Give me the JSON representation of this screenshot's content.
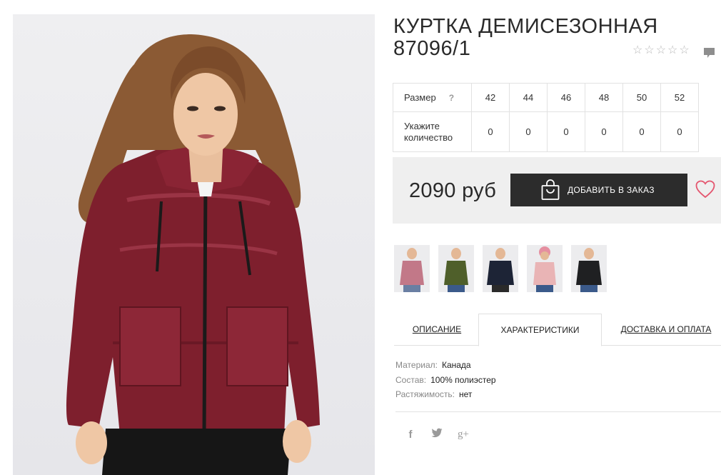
{
  "product": {
    "title": "КУРТКА ДЕМИСЕЗОННАЯ 87096/1",
    "rating_stars": 5,
    "image": "burgundy-puffer-jacket-photo"
  },
  "size_table": {
    "size_label": "Размер",
    "help_mark": "?",
    "qty_label": "Укажите количество",
    "sizes": [
      "42",
      "44",
      "46",
      "48",
      "50",
      "52"
    ],
    "quantities": [
      "0",
      "0",
      "0",
      "0",
      "0",
      "0"
    ]
  },
  "purchase": {
    "price": "2090 руб",
    "add_button": "ДОБАВИТЬ В ЗАКАЗ"
  },
  "thumbnails": [
    {
      "color": "#8a2a3b"
    },
    {
      "color": "#4f5f2a"
    },
    {
      "color": "#1d2436"
    },
    {
      "color": "#e9b4b5"
    },
    {
      "color": "#1f2022"
    }
  ],
  "tabs": [
    {
      "label": "ОПИСАНИЕ",
      "active": false
    },
    {
      "label": "ХАРАКТЕРИСТИКИ",
      "active": true
    },
    {
      "label": "ДОСТАВКА И ОПЛАТА",
      "active": false
    }
  ],
  "specs": [
    {
      "key": "Материал:",
      "value": "Канада"
    },
    {
      "key": "Состав:",
      "value": "100% полиэстер"
    },
    {
      "key": "Растяжимость:",
      "value": "нет"
    }
  ],
  "share": {
    "facebook": "f",
    "twitter": "t",
    "googleplus": "g+"
  },
  "colors": {
    "button_bg": "#2c2c2c",
    "heart": "#e4566f",
    "price_box_bg": "#efefef"
  }
}
